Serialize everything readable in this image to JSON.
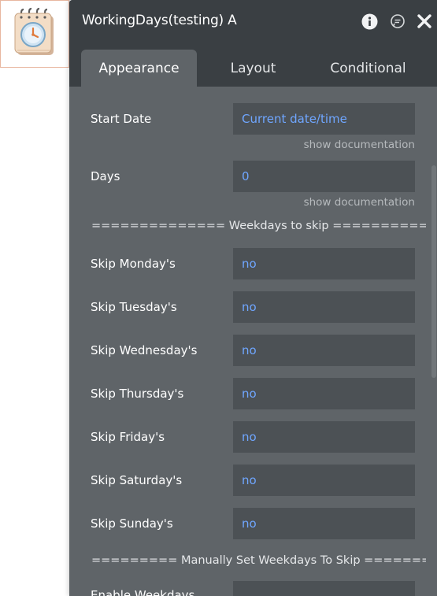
{
  "element": {
    "icon": "calendar-clock-icon"
  },
  "panel": {
    "title": "WorkingDays(testing) A",
    "header_icons": [
      "info-icon",
      "comment-icon",
      "close-icon"
    ],
    "tabs": [
      {
        "label": "Appearance",
        "active": true
      },
      {
        "label": "Layout",
        "active": false
      },
      {
        "label": "Conditional",
        "active": false
      }
    ]
  },
  "properties": {
    "start_date": {
      "label": "Start Date",
      "value": "Current date/time",
      "doc": "show documentation"
    },
    "days": {
      "label": "Days",
      "value": "0",
      "doc": "show documentation"
    },
    "weekdays_separator": "============== Weekdays to skip ==============",
    "skip_rows": [
      {
        "label": "Skip Monday's",
        "value": "no"
      },
      {
        "label": "Skip Tuesday's",
        "value": "no"
      },
      {
        "label": "Skip Wednesday's",
        "value": "no"
      },
      {
        "label": "Skip Thursday's",
        "value": "no"
      },
      {
        "label": "Skip Friday's",
        "value": "no"
      },
      {
        "label": "Skip Saturday's",
        "value": "no"
      },
      {
        "label": "Skip Sunday's",
        "value": "no"
      }
    ],
    "manual_separator": "========= Manually Set Weekdays To Skip ========",
    "partial_row": {
      "label": "Enable Weekdays"
    }
  },
  "colors": {
    "panel_bg": "#5f6468",
    "header_bg": "#3a3f43",
    "field_bg": "#4c5155",
    "value_text": "#6fa6ff"
  }
}
